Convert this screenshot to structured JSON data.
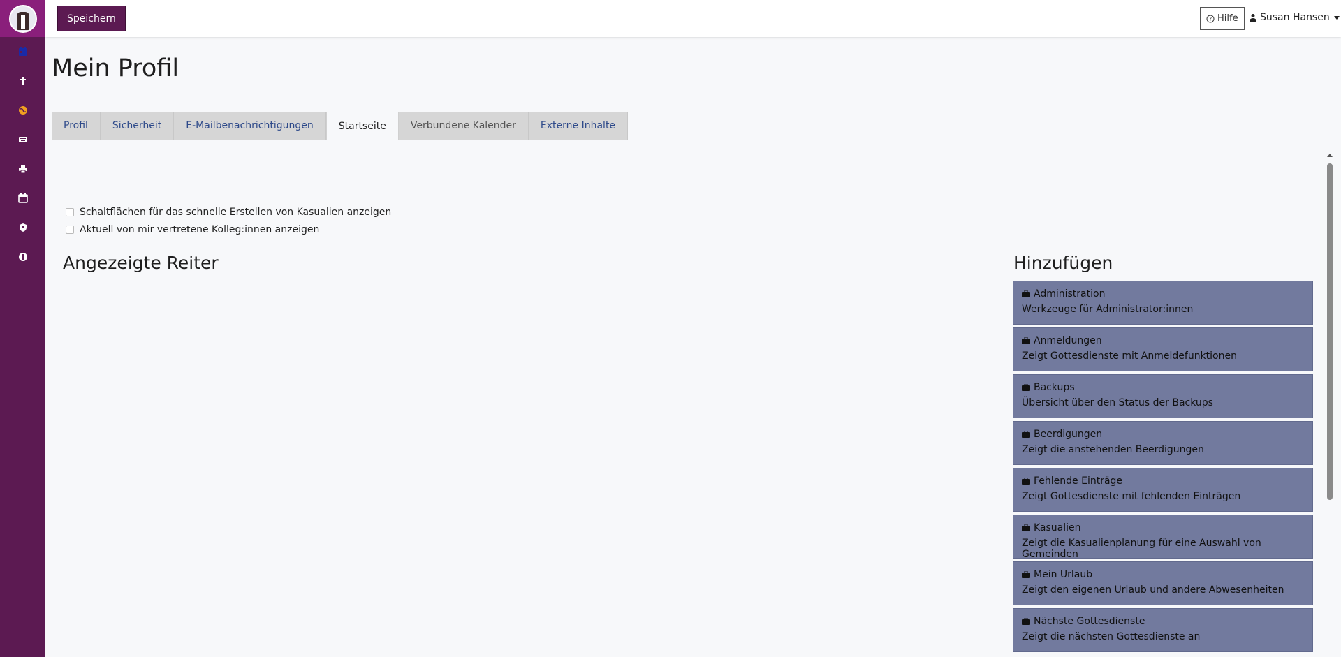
{
  "colors": {
    "sidebar": "#5c1a52",
    "logo_bg": "#8a1f7b",
    "save_button": "#5c1a52",
    "card_bg": "#727a9e",
    "tab_link": "#2e4a8a"
  },
  "sidebar": {
    "items": [
      {
        "icon": "calendar-day-icon",
        "color": "#1a2aa8"
      },
      {
        "icon": "cross-icon",
        "color": "#ffffff"
      },
      {
        "icon": "globe-icon",
        "color": "#f0a020"
      },
      {
        "icon": "keyboard-icon",
        "color": "#ffffff"
      },
      {
        "icon": "printer-icon",
        "color": "#ffffff"
      },
      {
        "icon": "calendar-icon",
        "color": "#ffffff"
      },
      {
        "icon": "user-shield-icon",
        "color": "#ffffff"
      },
      {
        "icon": "info-icon",
        "color": "#ffffff"
      }
    ]
  },
  "toolbar": {
    "save_label": "Speichern",
    "help_label": "Hilfe",
    "user_name": "Susan Hansen"
  },
  "page": {
    "title": "Mein Profil"
  },
  "tabs": [
    {
      "label": "Profil",
      "state": "link"
    },
    {
      "label": "Sicherheit",
      "state": "link"
    },
    {
      "label": "E-Mailbenachrichtigungen",
      "state": "link"
    },
    {
      "label": "Startseite",
      "state": "active"
    },
    {
      "label": "Verbundene Kalender",
      "state": "muted"
    },
    {
      "label": "Externe Inhalte",
      "state": "link"
    }
  ],
  "options": [
    {
      "label": "Schaltflächen für das schnelle Erstellen von Kasualien anzeigen",
      "checked": false
    },
    {
      "label": "Aktuell von mir vertretene Kolleg:innen anzeigen",
      "checked": false
    }
  ],
  "sections": {
    "shown_tabs_title": "Angezeigte Reiter",
    "add_title": "Hinzufügen"
  },
  "add_cards": [
    {
      "title": "Administration",
      "desc": "Werkzeuge für Administrator:innen"
    },
    {
      "title": "Anmeldungen",
      "desc": "Zeigt Gottesdienste mit Anmeldefunktionen"
    },
    {
      "title": "Backups",
      "desc": "Übersicht über den Status der Backups"
    },
    {
      "title": "Beerdigungen",
      "desc": "Zeigt die anstehenden Beerdigungen"
    },
    {
      "title": "Fehlende Einträge",
      "desc": "Zeigt Gottesdienste mit fehlenden Einträgen"
    },
    {
      "title": "Kasualien",
      "desc": "Zeigt die Kasualienplanung für eine Auswahl von Gemeinden"
    },
    {
      "title": "Mein Urlaub",
      "desc": "Zeigt den eigenen Urlaub und andere Abwesenheiten"
    },
    {
      "title": "Nächste Gottesdienste",
      "desc": "Zeigt die nächsten Gottesdienste an"
    }
  ]
}
